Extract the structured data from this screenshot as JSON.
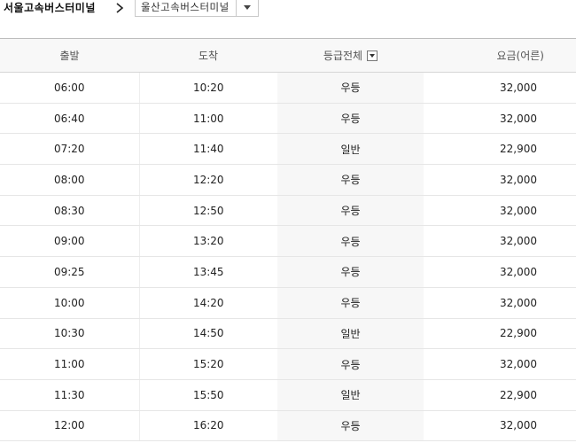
{
  "route": {
    "origin": "서울고속버스터미널",
    "destination": "울산고속버스터미널"
  },
  "icons": {
    "separator": "chevron-right-icon",
    "destination_dropdown": "caret-down-icon",
    "grade_filter": "caret-down-icon"
  },
  "table": {
    "headers": {
      "departure": "출발",
      "arrival": "도착",
      "grade": "등급전체",
      "fare": "요금(어른)"
    },
    "rows": [
      {
        "departure": "06:00",
        "arrival": "10:20",
        "grade": "우등",
        "fare": "32,000"
      },
      {
        "departure": "06:40",
        "arrival": "11:00",
        "grade": "우등",
        "fare": "32,000"
      },
      {
        "departure": "07:20",
        "arrival": "11:40",
        "grade": "일반",
        "fare": "22,900"
      },
      {
        "departure": "08:00",
        "arrival": "12:20",
        "grade": "우등",
        "fare": "32,000"
      },
      {
        "departure": "08:30",
        "arrival": "12:50",
        "grade": "우등",
        "fare": "32,000"
      },
      {
        "departure": "09:00",
        "arrival": "13:20",
        "grade": "우등",
        "fare": "32,000"
      },
      {
        "departure": "09:25",
        "arrival": "13:45",
        "grade": "우등",
        "fare": "32,000"
      },
      {
        "departure": "10:00",
        "arrival": "14:20",
        "grade": "우등",
        "fare": "32,000"
      },
      {
        "departure": "10:30",
        "arrival": "14:50",
        "grade": "일반",
        "fare": "22,900"
      },
      {
        "departure": "11:00",
        "arrival": "15:20",
        "grade": "우등",
        "fare": "32,000"
      },
      {
        "departure": "11:30",
        "arrival": "15:50",
        "grade": "일반",
        "fare": "22,900"
      },
      {
        "departure": "12:00",
        "arrival": "16:20",
        "grade": "우등",
        "fare": "32,000"
      }
    ]
  }
}
